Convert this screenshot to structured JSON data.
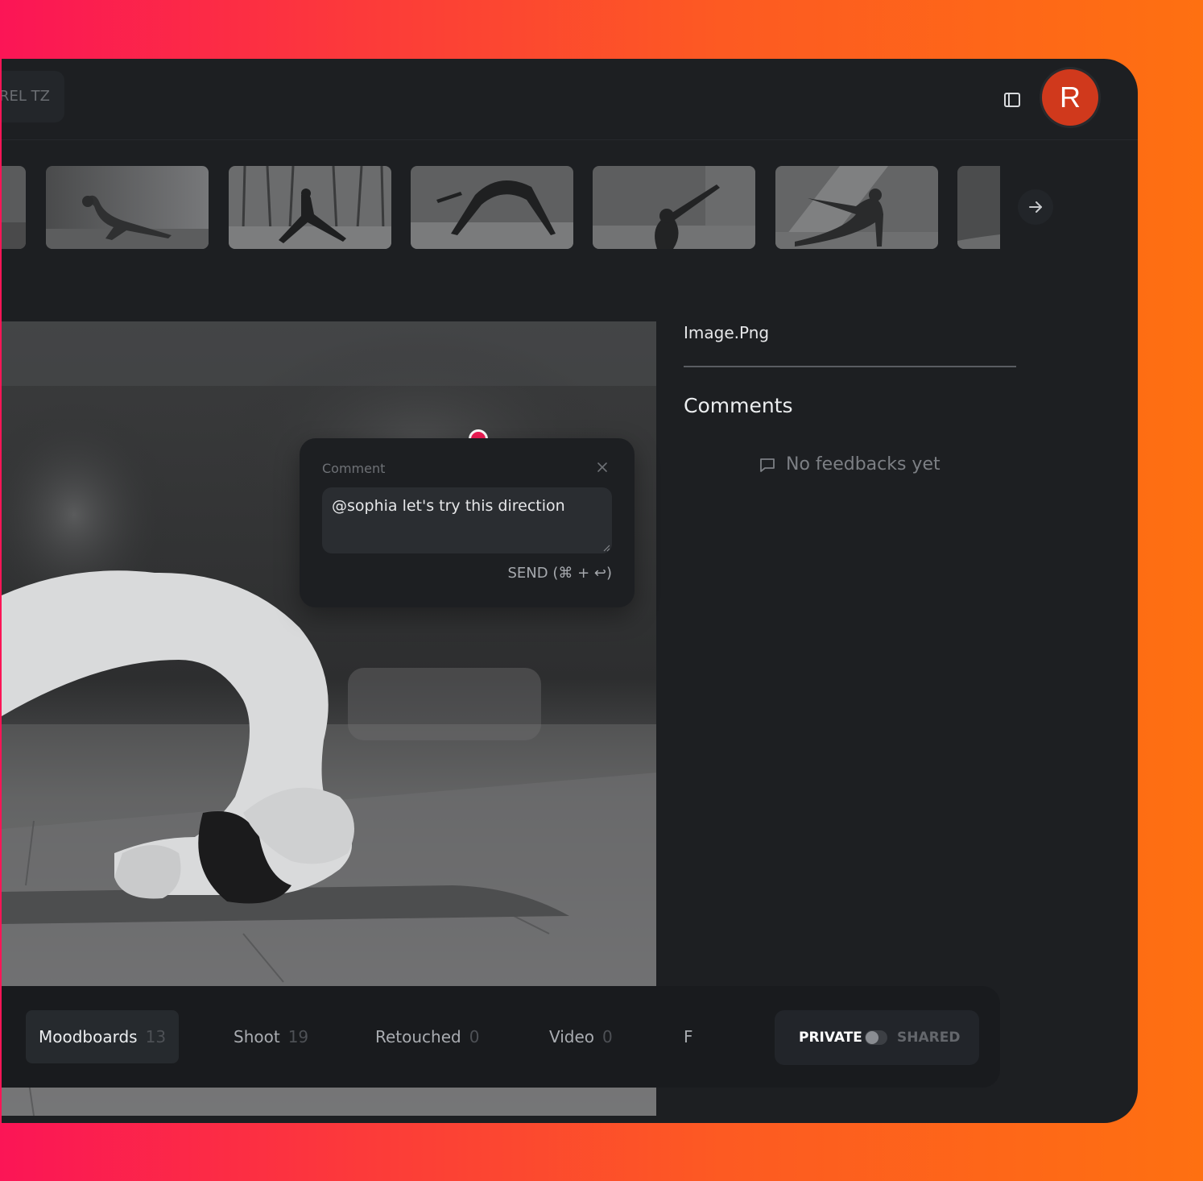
{
  "header": {
    "tag_label": "REL TZ",
    "avatar_initial": "R"
  },
  "preview": {
    "filename": "Image.Png",
    "comments_title": "Comments",
    "empty_state": "No feedbacks yet"
  },
  "comment_popup": {
    "label": "Comment",
    "value": "@sophia let's try this direction",
    "send_label": "SEND (⌘ + ↩)"
  },
  "tabs": [
    {
      "label": "Moodboards",
      "count": "13"
    },
    {
      "label": "Shoot",
      "count": "19"
    },
    {
      "label": "Retouched",
      "count": "0"
    },
    {
      "label": "Video",
      "count": "0"
    },
    {
      "label": "F",
      "count": ""
    }
  ],
  "visibility": {
    "private_label": "PRIVATE",
    "shared_label": "SHARED",
    "shared": false
  },
  "colors": {
    "accent_marker": "#f21d55",
    "avatar": "#d0391c",
    "background_gradient_start": "#fb1556",
    "background_gradient_end": "#fe7011"
  }
}
